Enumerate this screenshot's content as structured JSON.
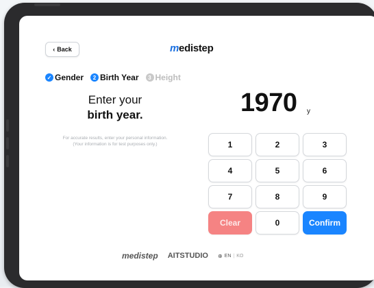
{
  "header": {
    "back_label": "Back",
    "logo": {
      "accent": "m",
      "rest": "edistep"
    }
  },
  "steps": [
    {
      "number": "✓",
      "label": "Gender",
      "state": "done"
    },
    {
      "number": "2",
      "label": "Birth Year",
      "state": "active"
    },
    {
      "number": "3",
      "label": "Height",
      "state": "pending"
    }
  ],
  "prompt": {
    "line1": "Enter your",
    "line2": "birth year.",
    "note_line1": "For accurate results, enter your personal information.",
    "note_line2": "(Your information is for test purposes only.)"
  },
  "display": {
    "year": "1970",
    "unit": "y"
  },
  "keypad": {
    "keys": [
      "1",
      "2",
      "3",
      "4",
      "5",
      "6",
      "7",
      "8",
      "9"
    ],
    "clear_label": "Clear",
    "zero_label": "0",
    "confirm_label": "Confirm"
  },
  "footer": {
    "brand1": "medistep",
    "brand2": "AITSTUDIO",
    "lang_active": "EN",
    "lang_sep": "|",
    "lang_other": "KO"
  },
  "colors": {
    "accent": "#1a85ff",
    "clear": "#f58383",
    "frame": "#2b2b2d"
  }
}
